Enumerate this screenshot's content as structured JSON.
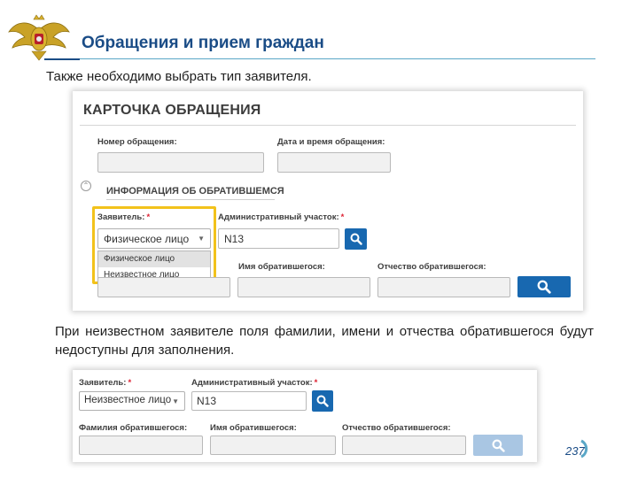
{
  "header": {
    "title": "Обращения и прием граждан"
  },
  "intro_text": "Также необходимо выбрать тип заявителя.",
  "card": {
    "title": "КАРТОЧКА ОБРАЩЕНИЯ",
    "number_label": "Номер обращения:",
    "number_value": "",
    "datetime_label": "Дата и время обращения:",
    "datetime_value": "",
    "section_title": "ИНФОРМАЦИЯ ОБ ОБРАТИВШЕМСЯ",
    "applicant_label": "Заявитель:",
    "required_mark": "*",
    "applicant_value": "Физическое лицо",
    "applicant_options": [
      "Физическое лицо",
      "Неизвестное лицо"
    ],
    "district_label": "Административный участок:",
    "district_value": "N13",
    "first_name_label": "Имя обратившегося:",
    "patronymic_label": "Отчество обратившегося:"
  },
  "note_text": "При неизвестном заявителе поля фамилии, имени и отчества обратившегося будут недоступны для заполнения.",
  "card2": {
    "applicant_label": "Заявитель:",
    "applicant_value": "Неизвестное лицо",
    "district_label": "Административный участок:",
    "district_value": "N13",
    "surname_label": "Фамилия обратившегося:",
    "first_name_label": "Имя обратившегося:",
    "patronymic_label": "Отчество обратившегося:"
  },
  "page_number": "237",
  "colors": {
    "brand_blue": "#1a4c86",
    "search_button": "#1868b0",
    "search_button_disabled": "#a9c6e3",
    "highlight": "#f2c21b"
  },
  "icons": [
    "emblem-icon",
    "search-icon",
    "collapse-icon",
    "chevron-down-icon"
  ]
}
